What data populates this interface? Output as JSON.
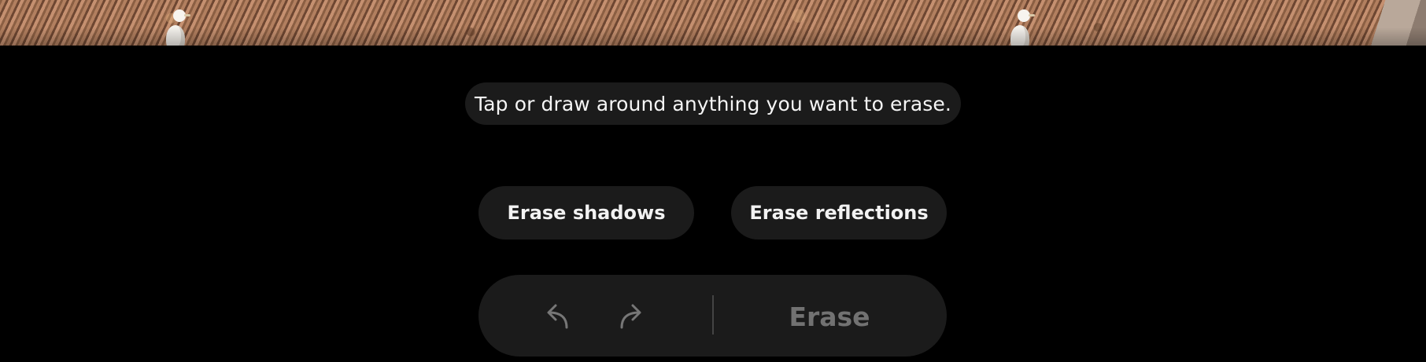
{
  "photo": {
    "alt_icons": [
      "seagull",
      "seagull",
      "wooden-post"
    ]
  },
  "hint": {
    "text": "Tap or draw around anything you want to erase."
  },
  "options": {
    "shadows_label": "Erase shadows",
    "reflections_label": "Erase reflections"
  },
  "toolbar": {
    "undo_icon": "undo-icon",
    "redo_icon": "redo-icon",
    "erase_label": "Erase",
    "erase_enabled": false,
    "icon_color": "#777777"
  },
  "colors": {
    "background": "#000000",
    "pill": "#1b1b1b",
    "text": "#f5f5f5",
    "disabled_text": "#727272"
  }
}
